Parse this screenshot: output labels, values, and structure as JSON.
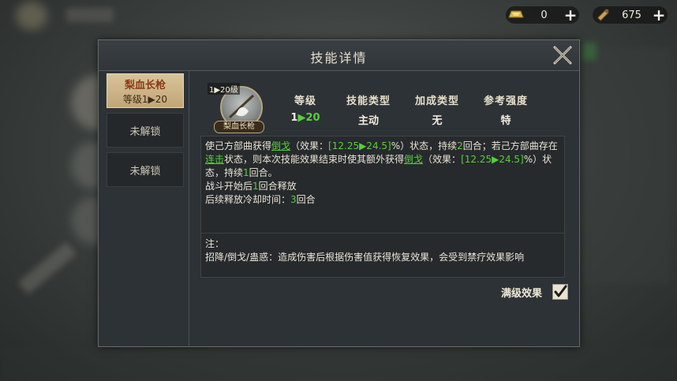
{
  "currencies": [
    {
      "icon": "gold-ingot-icon",
      "value": "0"
    },
    {
      "icon": "scroll-icon",
      "value": "675"
    }
  ],
  "dialog": {
    "title": "技能详情",
    "tabs": [
      {
        "name": "梨血长枪",
        "level": "等级1▶20",
        "active": true
      },
      {
        "name": "未解锁",
        "active": false
      },
      {
        "name": "未解锁",
        "active": false
      }
    ],
    "skill": {
      "icon_level": "1▶20级",
      "icon_name": "梨血长枪"
    },
    "stats": [
      {
        "header": "等级",
        "value_prefix": "1",
        "value_accent": "▶20"
      },
      {
        "header": "技能类型",
        "value": "主动"
      },
      {
        "header": "加成类型",
        "value": "无"
      },
      {
        "header": "参考强度",
        "value": "特"
      }
    ],
    "description": {
      "p1a": "使己方部曲获得",
      "p1b": "倒戈",
      "p1c": "（效果：",
      "p1d": "[12.25▶24.5]",
      "p1e": "%）状态，持续",
      "p1f": "2",
      "p1g": "回合；若己方部曲存在",
      "p1h": "连击",
      "p1i": "状态，则本次技能效果结束时使其额外获得",
      "p1j": "倒戈",
      "p1k": "（效果：",
      "p1l": "[12.25▶24.5]",
      "p1m": "%）状态，持续",
      "p1n": "1",
      "p1o": "回合。",
      "line2a": "战斗开始后",
      "line2b": "1",
      "line2c": "回合释放",
      "line3a": "后续释放冷却时间：",
      "line3b": "3",
      "line3c": "回合"
    },
    "note": {
      "label": "注：",
      "text": "招降/倒戈/蛊惑：造成伤害后根据伤害值获得恢复效果，会受到禁疗效果影响"
    },
    "max_level_label": "满级效果",
    "max_level_checked": true
  },
  "colors": {
    "accent_green": "#58cf3c",
    "gold": "#c2a577"
  }
}
